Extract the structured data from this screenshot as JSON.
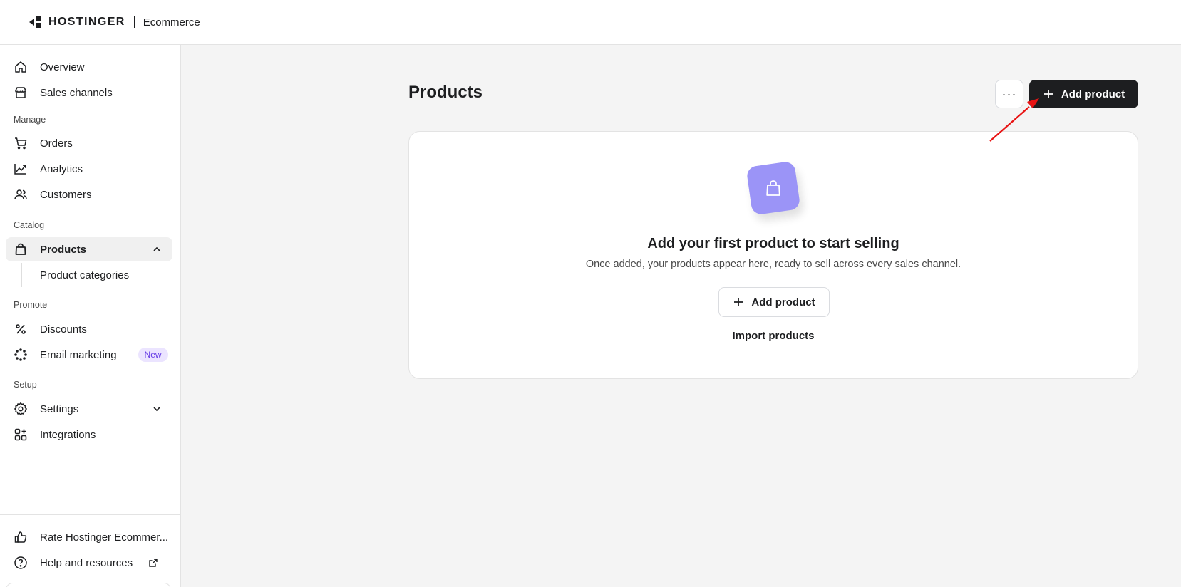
{
  "header": {
    "brand": "HOSTINGER",
    "product": "Ecommerce"
  },
  "sidebar": {
    "top_items": [
      {
        "label": "Overview",
        "icon": "home-icon"
      },
      {
        "label": "Sales channels",
        "icon": "store-icon"
      }
    ],
    "sections": {
      "manage": "Manage",
      "catalog": "Catalog",
      "promote": "Promote",
      "setup": "Setup"
    },
    "manage_items": [
      {
        "label": "Orders",
        "icon": "cart-icon"
      },
      {
        "label": "Analytics",
        "icon": "trend-icon"
      },
      {
        "label": "Customers",
        "icon": "users-icon"
      }
    ],
    "catalog_items": {
      "products": "Products",
      "product_categories": "Product categories"
    },
    "promote_items": {
      "discounts": "Discounts",
      "email_marketing": "Email marketing",
      "new_badge": "New"
    },
    "setup_items": {
      "settings": "Settings",
      "integrations": "Integrations"
    },
    "footer_items": {
      "rate": "Rate Hostinger Ecommer...",
      "help": "Help and resources"
    }
  },
  "main": {
    "title": "Products",
    "more_label": "···",
    "add_product_label": "Add product",
    "empty_state": {
      "title": "Add your first product to start selling",
      "description": "Once added, your products appear here, ready to sell across every sales channel.",
      "add_button_label": "Add product",
      "import_label": "Import products"
    }
  },
  "colors": {
    "accent": "#673de6",
    "primary_button": "#1d1e20",
    "empty_tile": "#9b94f7",
    "annotation_arrow": "#e81414"
  }
}
